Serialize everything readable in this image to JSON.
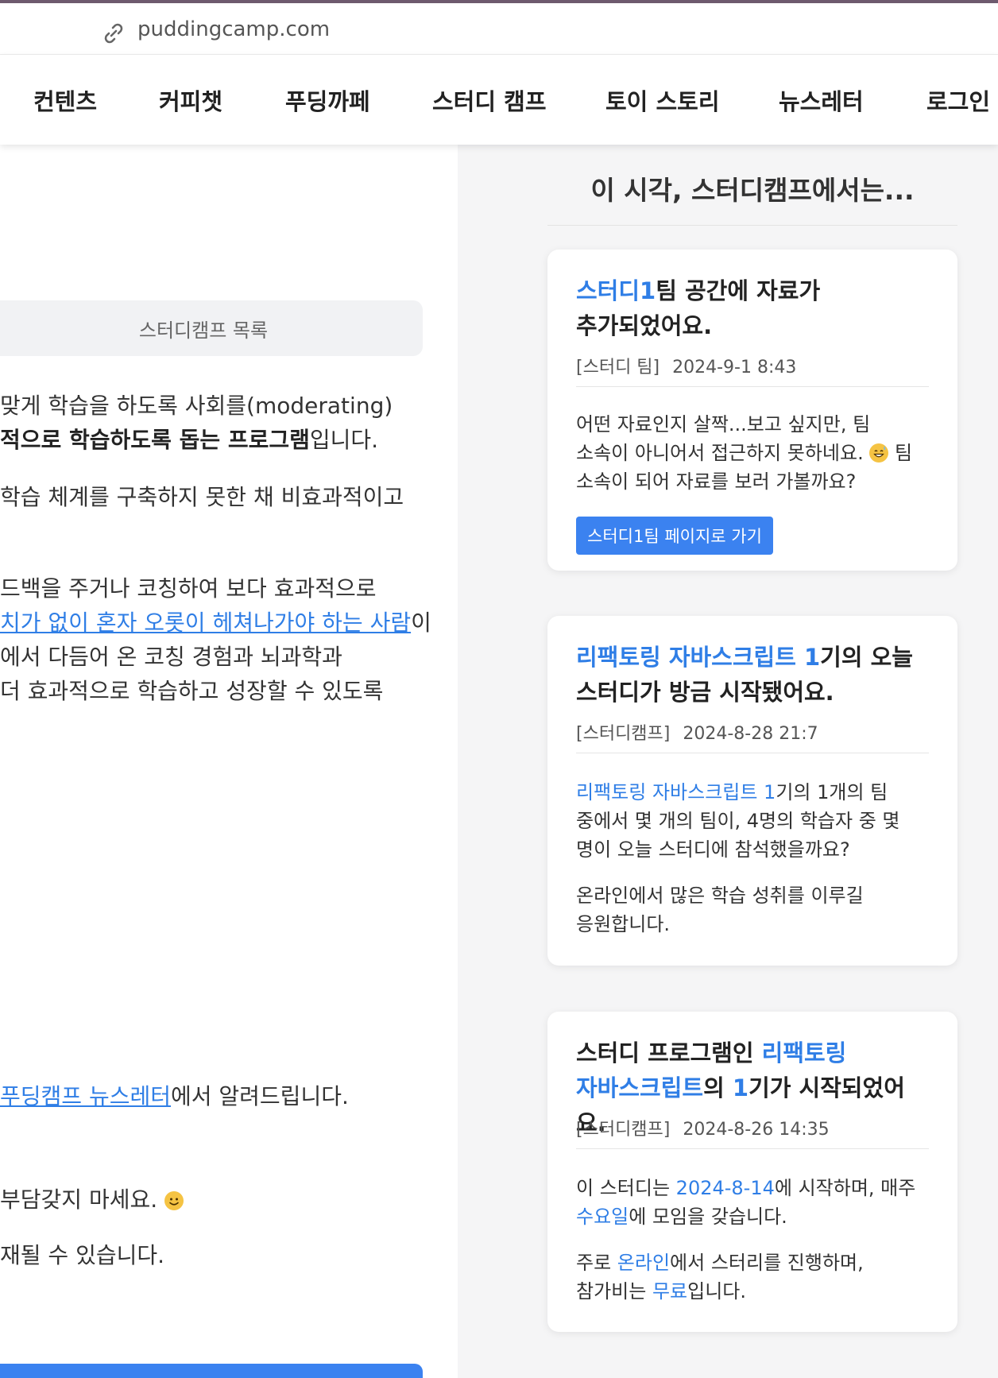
{
  "url": {
    "text": "puddingcamp.com"
  },
  "nav": {
    "items": [
      "컨텐츠",
      "커피챗",
      "푸딩까페",
      "스터디 캠프",
      "토이 스토리",
      "뉴스레터",
      "로그인"
    ]
  },
  "left": {
    "list_button": "스터디캠프 목록",
    "p1_l1": "맞게 학습을 하도록 사회를(moderating)",
    "p1_l2_bold": "적으로 학습하도록 돕는 프로그램",
    "p1_l2_tail": "입니다.",
    "p2": "학습 체계를 구축하지 못한 채 비효과적이고",
    "p3_l1": "드백을 주거나 코칭하여 보다 효과적으로",
    "p3_l2_link": "치가 없이 혼자 오롯이 헤쳐나가야 하는 사람",
    "p3_l2_tail": "이",
    "p3_l3": "에서 다듬어 온 코칭 경험과 뇌과학과",
    "p3_l4": " 더 효과적으로 학습하고 성장할 수 있도록",
    "p4_link": "푸딩캠프 뉴스레터",
    "p4_tail": "에서 알려드립니다.",
    "p5": "부담갖지 마세요. ",
    "p6": "재될 수 있습니다."
  },
  "sidebar": {
    "title": "이 시각, 스터디캠프에서는...",
    "cards": [
      {
        "title_hl": "스터디1",
        "title_rest_1": "팀 공간에 자료가",
        "title_rest_2": "추가되었어요.",
        "tag": "[스터디 팀]",
        "date": "2024-9-1 8:43",
        "body_l1": "어떤 자료인지 살짝...보고 싶지만, 팀",
        "body_l2a": "소속이 아니어서 접근하지 못하네요. ",
        "body_l2b": " 팀",
        "body_l3": "소속이 되어 자료를 보러 가볼까요?",
        "button": "스터디1팀 페이지로 가기"
      },
      {
        "title_hl": "리팩토링 자바스크립트 1",
        "title_rest_1": "기의 오늘",
        "title_rest_2": "스터디가 방금 시작됐어요.",
        "tag": "[스터디캠프]",
        "date": "2024-8-28 21:7",
        "body_hl": "리팩토링 자바스크립트 1",
        "body_l1_rest": "기의 1개의 팀",
        "body_l2": "중에서 몇 개의 팀이, 4명의 학습자 중 몇",
        "body_l3": "명이 오늘 스터디에 참석했을까요?",
        "body_l4": "온라인에서 많은 학습 성취를 이루길",
        "body_l5": "응원합니다."
      },
      {
        "title_a": "스터디 프로그램인 ",
        "title_hl1": "리팩토링",
        "title_hl2": "자바스크립트",
        "title_b": "의 ",
        "title_hl3": "1",
        "title_c": "기가 시작되었어요.",
        "tag": "[스터디캠프]",
        "date": "2024-8-26 14:35",
        "body_a": "이 스터디는 ",
        "body_date": "2024-8-14",
        "body_b": "에 시작하며, 매주",
        "body_day": "수요일",
        "body_c": "에 모임을 갖습니다.",
        "body_d": "주로 ",
        "body_online": "온라인",
        "body_e": "에서 스터리를 진행하며,",
        "body_f": "참가비는 ",
        "body_free": "무료",
        "body_g": "입니다."
      }
    ]
  }
}
